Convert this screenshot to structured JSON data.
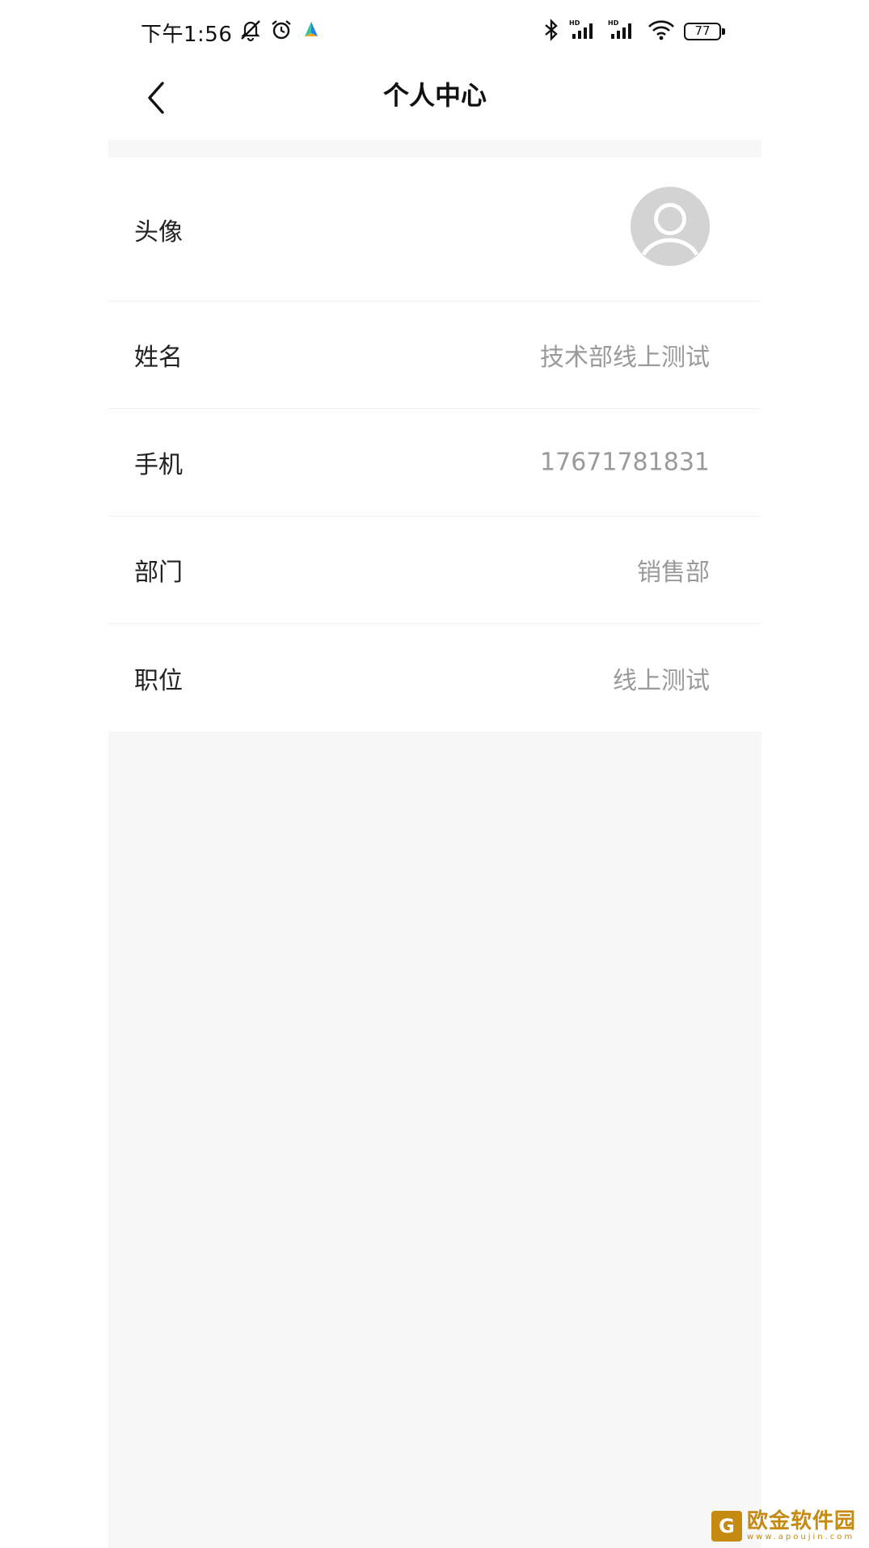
{
  "status_bar": {
    "time": "下午1:56",
    "battery": "77",
    "icons_left": [
      "mute-bell-icon",
      "alarm-icon",
      "app-icon"
    ],
    "icons_right": [
      "bluetooth-icon",
      "signal-hd-icon",
      "signal-hd-icon",
      "wifi-icon",
      "battery-icon"
    ]
  },
  "nav": {
    "title": "个人中心",
    "back_icon": "chevron-left-icon"
  },
  "profile": {
    "rows": [
      {
        "label": "头像",
        "type": "avatar"
      },
      {
        "label": "姓名",
        "value": "技术部线上测试"
      },
      {
        "label": "手机",
        "value": "17671781831"
      },
      {
        "label": "部门",
        "value": "销售部"
      },
      {
        "label": "职位",
        "value": "线上测试"
      }
    ]
  },
  "watermark": {
    "text": "欧金软件园",
    "sub": "www.apoujin.com"
  },
  "colors": {
    "background": "#f7f7f7",
    "card": "#ffffff",
    "label": "#222222",
    "value": "#9a9a9a",
    "watermark": "#c58a10"
  }
}
